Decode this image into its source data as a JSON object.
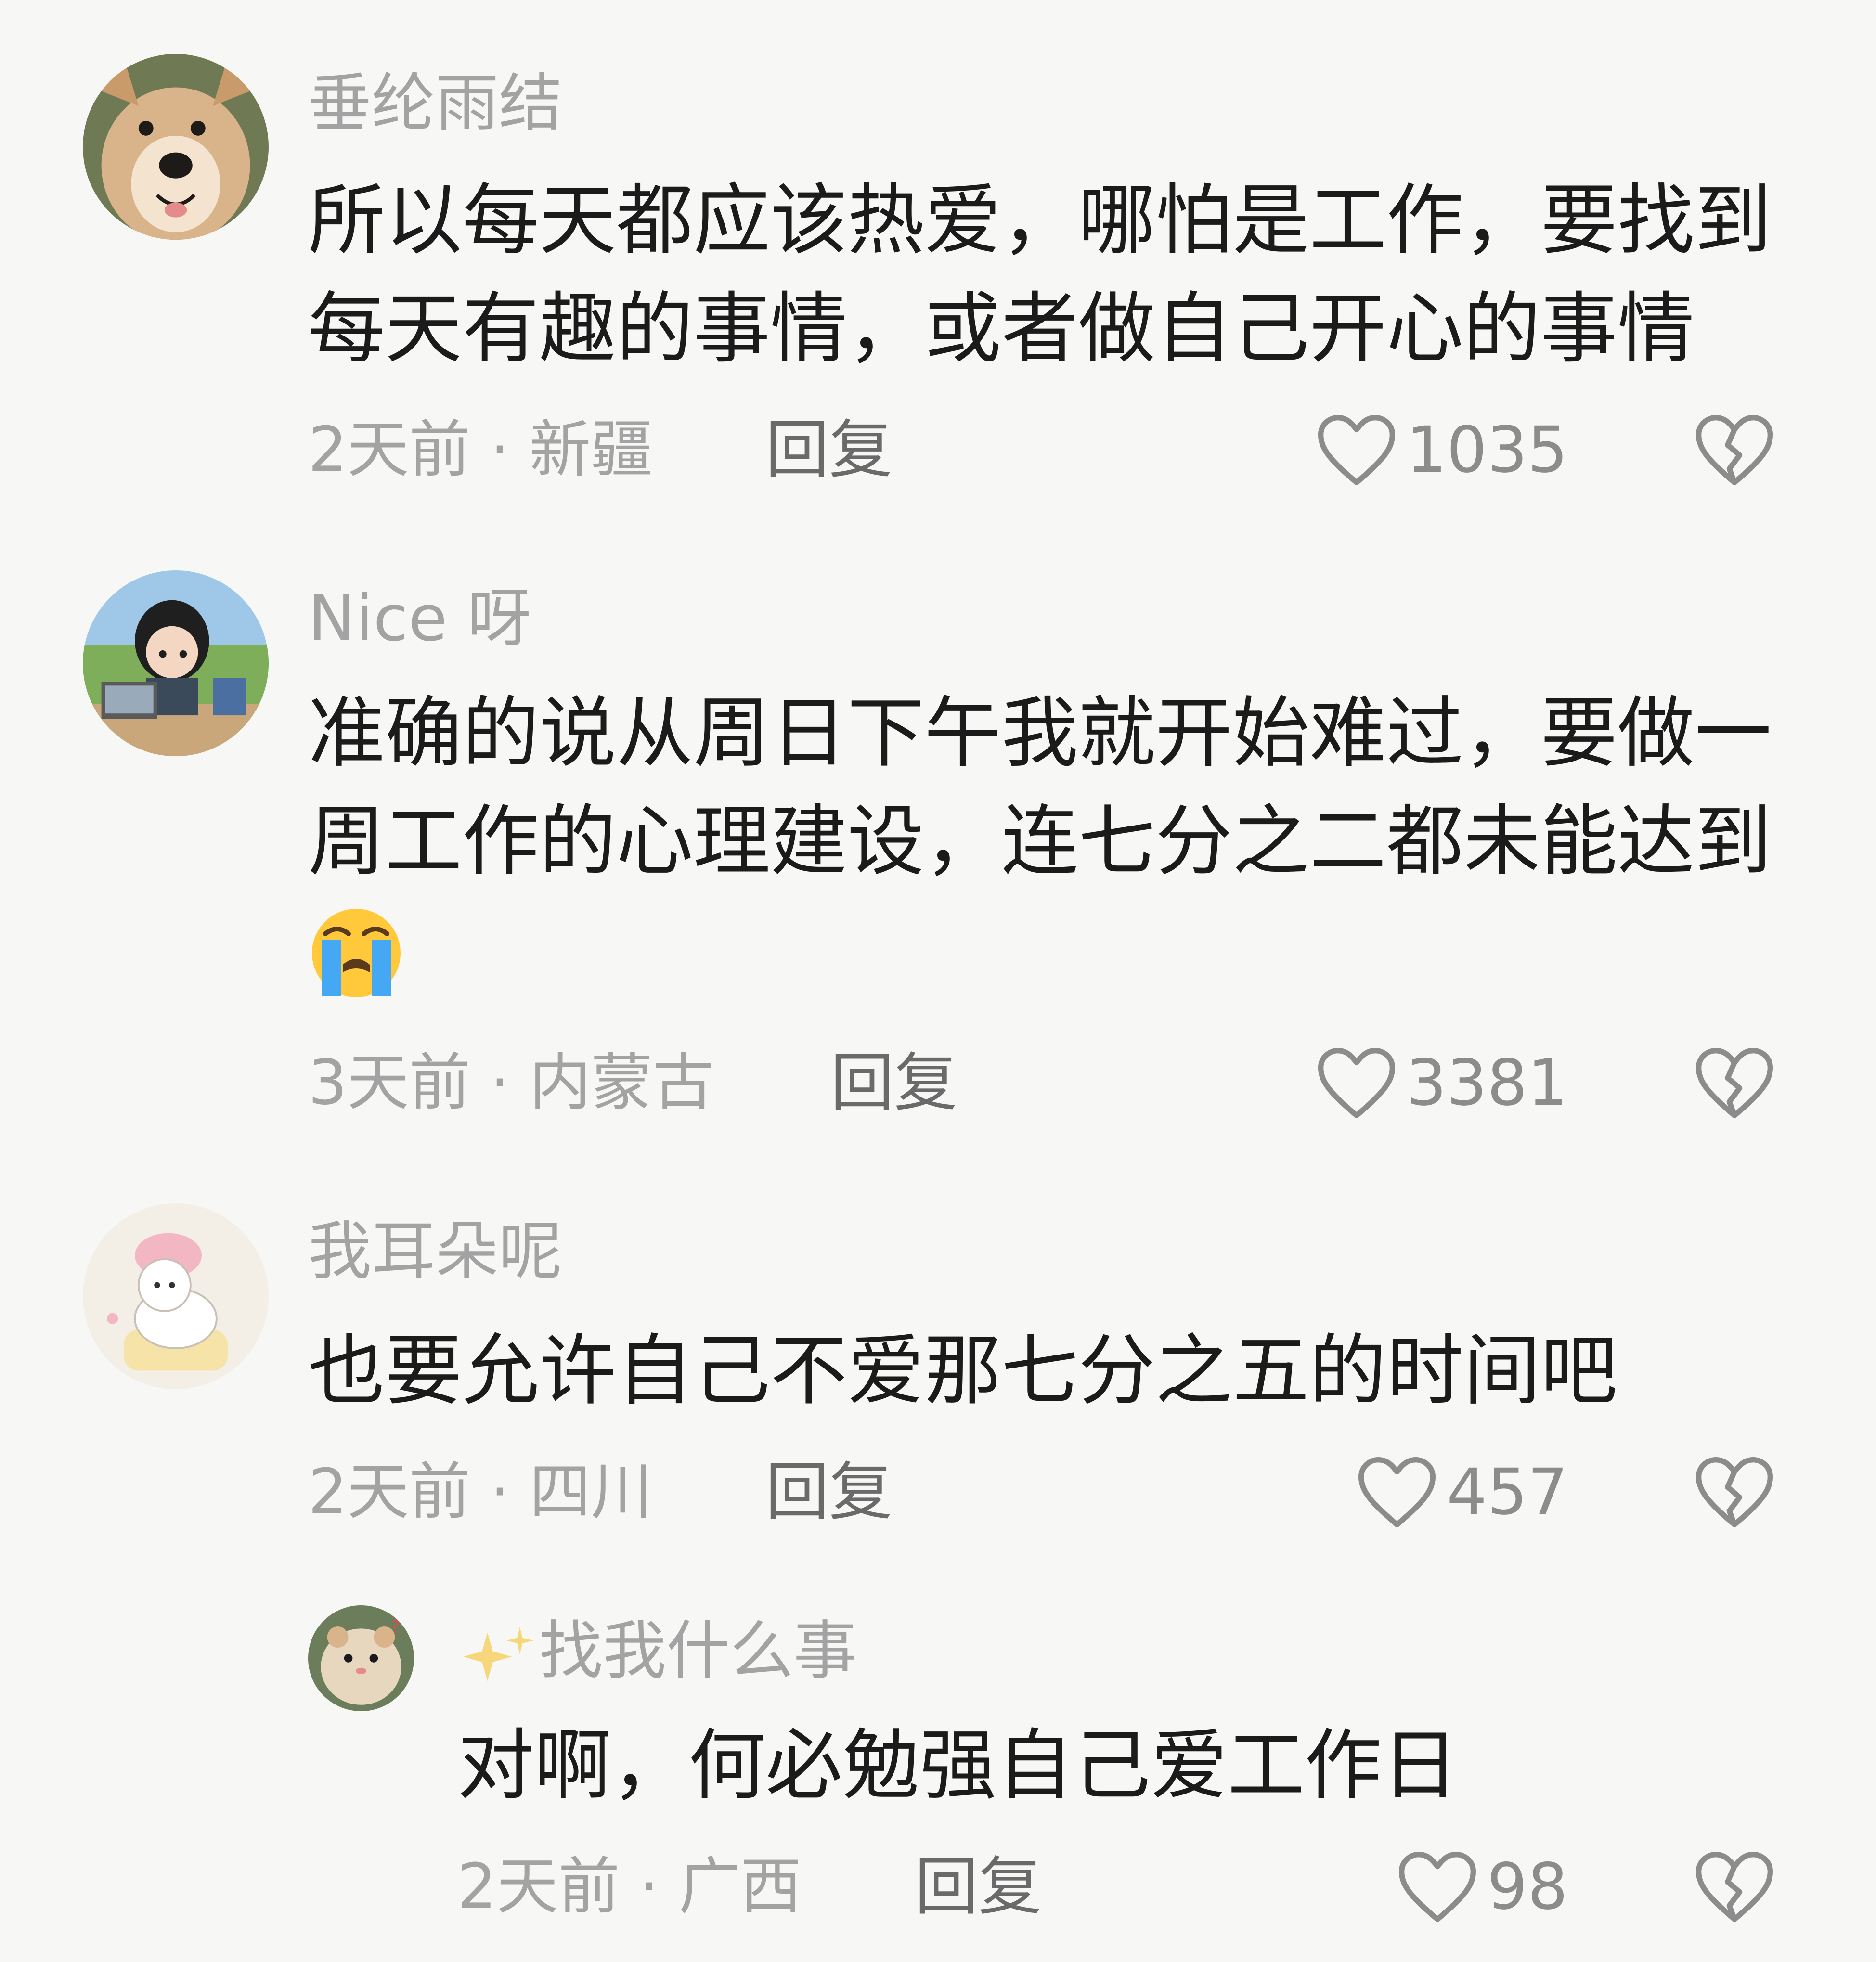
{
  "comments": [
    {
      "username": "垂纶雨结",
      "text_line1": "所以每天都应该热爱，哪怕是工作，要找到",
      "text_line2": "每天有趣的事情，或者做自己开心的事情",
      "meta": "2天前 · 新疆",
      "reply": "回复",
      "likes": "1035",
      "avatar_icon": "dog-avatar-icon"
    },
    {
      "username": "Nice 呀",
      "text_line1": "准确的说从周日下午我就开始难过，要做一",
      "text_line2": "周工作的心理建设，连七分之二都未能达到",
      "emoji": "loudly-crying-face-emoji",
      "meta": "3天前 · 内蒙古",
      "reply": "回复",
      "likes": "3381",
      "avatar_icon": "girl-laptop-avatar-icon"
    },
    {
      "username": "我耳朵呢",
      "text_line1": "也要允许自己不爱那七分之五的时间吧",
      "meta": "2天前 · 四川",
      "reply": "回复",
      "likes": "457",
      "avatar_icon": "cat-towel-avatar-icon"
    }
  ],
  "reply_comment": {
    "username": "找我什么事",
    "username_prefix_icon": "sparkles-icon",
    "text": "对啊，何必勉强自己爱工作日",
    "meta": "2天前 · 广西",
    "reply": "回复",
    "likes": "98",
    "avatar_icon": "hamster-avatar-icon"
  },
  "colors": {
    "background": "#f7f7f5",
    "username": "#a3a3a3",
    "content": "#1b1b1b",
    "meta": "#a3a3a3",
    "icon": "#8c8c8c"
  }
}
